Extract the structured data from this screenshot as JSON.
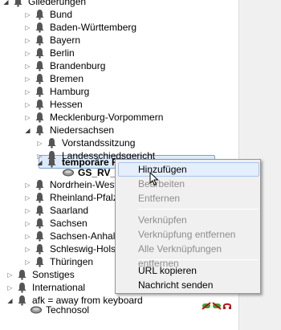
{
  "tree": {
    "items": [
      {
        "label": "Gliederungen",
        "arrow": "expanded",
        "bold": false
      },
      {
        "label": "Bund",
        "arrow": "collapsed",
        "bold": false
      },
      {
        "label": "Baden-Württemberg",
        "arrow": "collapsed",
        "bold": false
      },
      {
        "label": "Bayern",
        "arrow": "collapsed",
        "bold": false
      },
      {
        "label": "Berlin",
        "arrow": "collapsed",
        "bold": false
      },
      {
        "label": "Brandenburg",
        "arrow": "collapsed",
        "bold": false
      },
      {
        "label": "Bremen",
        "arrow": "collapsed",
        "bold": false
      },
      {
        "label": "Hamburg",
        "arrow": "collapsed",
        "bold": false
      },
      {
        "label": "Hessen",
        "arrow": "collapsed",
        "bold": false
      },
      {
        "label": "Mecklenburg-Vorpommern",
        "arrow": "collapsed",
        "bold": false
      },
      {
        "label": "Niedersachsen",
        "arrow": "expanded",
        "bold": false
      },
      {
        "label": "Vorstandssitzung",
        "arrow": "collapsed",
        "bold": false
      },
      {
        "label": "Landesschiedsgericht",
        "arrow": "collapsed",
        "bold": false
      },
      {
        "label": "temporäre Rä",
        "arrow": "expanded",
        "bold": true
      },
      {
        "label": "GS_RV_Ha",
        "arrow": "none",
        "bold": true
      },
      {
        "label": "Nordrhein-Westfal",
        "arrow": "collapsed",
        "bold": false
      },
      {
        "label": "Rheinland-Pfalz",
        "arrow": "collapsed",
        "bold": false
      },
      {
        "label": "Saarland",
        "arrow": "collapsed",
        "bold": false
      },
      {
        "label": "Sachsen",
        "arrow": "collapsed",
        "bold": false
      },
      {
        "label": "Sachsen-Anhalt",
        "arrow": "collapsed",
        "bold": false
      },
      {
        "label": "Schleswig-Holstein",
        "arrow": "collapsed",
        "bold": false
      },
      {
        "label": "Thüringen",
        "arrow": "collapsed",
        "bold": false
      },
      {
        "label": "Sonstiges",
        "arrow": "collapsed",
        "bold": false
      },
      {
        "label": "International",
        "arrow": "collapsed",
        "bold": false
      },
      {
        "label": "afk = away from keyboard",
        "arrow": "expanded",
        "bold": false
      },
      {
        "label": "Technosol",
        "arrow": "none",
        "bold": false
      }
    ]
  },
  "context_menu": {
    "items": [
      {
        "label": "Hinzufügen",
        "disabled": false,
        "hover": true
      },
      {
        "label": "Bearbeiten",
        "disabled": true
      },
      {
        "label": "Entfernen",
        "disabled": true
      },
      {
        "label": "Verknüpfen",
        "disabled": true
      },
      {
        "label": "Verknüpfung entfernen",
        "disabled": true
      },
      {
        "label": "Alle Verknüpfungen entfernen",
        "disabled": true
      },
      {
        "label": "URL kopieren",
        "disabled": false
      },
      {
        "label": "Nachricht senden",
        "disabled": false
      }
    ]
  },
  "icons": {
    "channel": "bell-icon",
    "user": "user-disc-icon",
    "status": [
      "muted-mic-icon",
      "muted-speaker-icon",
      "muted-headset-icon"
    ]
  },
  "colors": {
    "selection_bg": "#dcebfc",
    "selection_border": "#7da2ce",
    "menu_bg": "#f0f0f0",
    "disabled_text": "#8d8d8d"
  }
}
